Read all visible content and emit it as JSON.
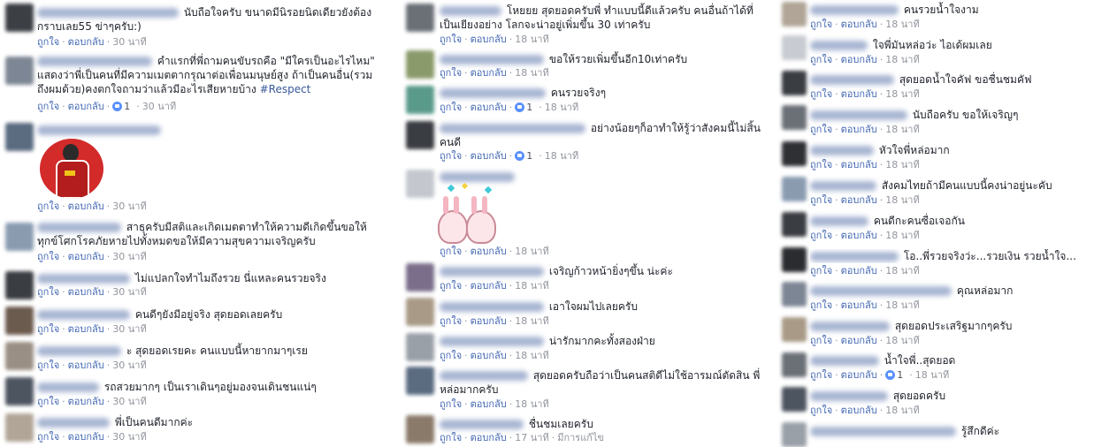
{
  "actions": {
    "like": "ถูกใจ",
    "reply": "ตอบกลับ",
    "dot": "·",
    "edited": "มีการแก้ไข"
  },
  "times": {
    "t30": "30 นาที",
    "t18": "18 นาที",
    "t17": "17 นาที"
  },
  "reaction_count": "1",
  "comments": {
    "c1": "นับถือใจครับ ขนาดมีนิรอยนิดเดียวยังต้องกราบเลย55 ข่าๆครับ:)",
    "c2": "คำแรกที่พี่ถามคนขับรถคือ \"มีใครเป็นอะไรไหม\" แสดงว่าพี่เป็นคนที่มีความเมตตากรุณาต่อเพื่อนมนุษย์สูง ถ้าเป็นคนอื่น(รวมถึงผมด้วย)คงตกใจถามว่าแล้วมีอะไรเสียหายบ้าง",
    "c2_tag": "#Respect",
    "c4": "สาธุครับมีสติและเกิดเมตตาทำให้ความดีเกิดขึ้นขอให้ทุกข์โศกโรคภัยหายไปทั้งหมดขอให้มีความสุขความเจริญครับ",
    "c5": "ไม่แปลกใจทำไมถึงรวย นี่แหละคนรวยจริง",
    "c6": "คนดีๆยังมีอยู่จริง สุดยอดเลยครับ",
    "c7": "ะ สุดยอดเรยคะ คนแบบนี้หายากมาๆเรย",
    "c8": "รถสวยมากๆ เป็นเราเดินๆอยู่มองจนเดินชนแน่ๆ",
    "c9": "พี่เป็นคนดีมากค่ะ",
    "m1": "โหยยย สุดยอดครับพี่ ทำแบบนี้ดีแล้วครับ คนอื่นถ้าได้ที่เป็นเยียงอย่าง โลกจะน่าอยู่เพิ่มขึ้น 30 เท่าครับ",
    "m2": "ขอให้รวยเพิ่มขึ้นอีก10เท่าครับ",
    "m3": "คนรวยจริงๆ",
    "m4": "อย่างน้อยๆก็อาทำให้รู้ว่าสังคมนี้ไม่สิ้นคนดี",
    "m6": "เจริญก้าวหน้ายิ่งๆขึ้น น่ะค่ะ",
    "m7": "เอาใจผมไปเลยครับ",
    "m8": "น่ารักมากคะทั้งสองฝ่าย",
    "m9": "สุดยอดครับถือว่าเป็นคนสติดีไม่ใช้อารมณ์ตัดสิน พี่หล่อมากครับ",
    "m10": "ชื่นชมเลยครับ",
    "r1": "คนรวยน้ำใจงาม",
    "r2": "ใจพี่มันหล่อว่ะ ไอเด้ผมเลย",
    "r3": "สุดยอดน้ำใจคัฟ ขอชื่นชมคัฟ",
    "r4": "นับถือครับ ขอให้เจริญๆ",
    "r5": "หัวใจพี่หล่อมาก",
    "r6": "สังคมไทยถ้ามีคนแบบนี้คงน่าอยู่นะคับ",
    "r7": "คนดีกะคนซื่อเจอกัน",
    "r8": "โอ..พี่รวยจริงว่ะ...รวยเงิน รวยน้ำใจ...",
    "r9": "คุณหล่อมาก",
    "r10": "สุดยอดประเสริฐมากๆครับ",
    "r11": "น้ำใจพี่..สุดยอด",
    "r12": "สุดยอดครับ",
    "r13": "รู้สึกดีค่ะ"
  },
  "avatar_colors": [
    "#6b7077",
    "#8a7a6a",
    "#5b6b80",
    "#3a3d42",
    "#9a8f84",
    "#7d8694",
    "#4d5560",
    "#b0a597"
  ],
  "sticker_colors": {
    "bunny": "#f4b6c2",
    "star": "#3ec8d8"
  },
  "profile_colors": {
    "red": "#d32a2a",
    "white": "#ffffff"
  }
}
